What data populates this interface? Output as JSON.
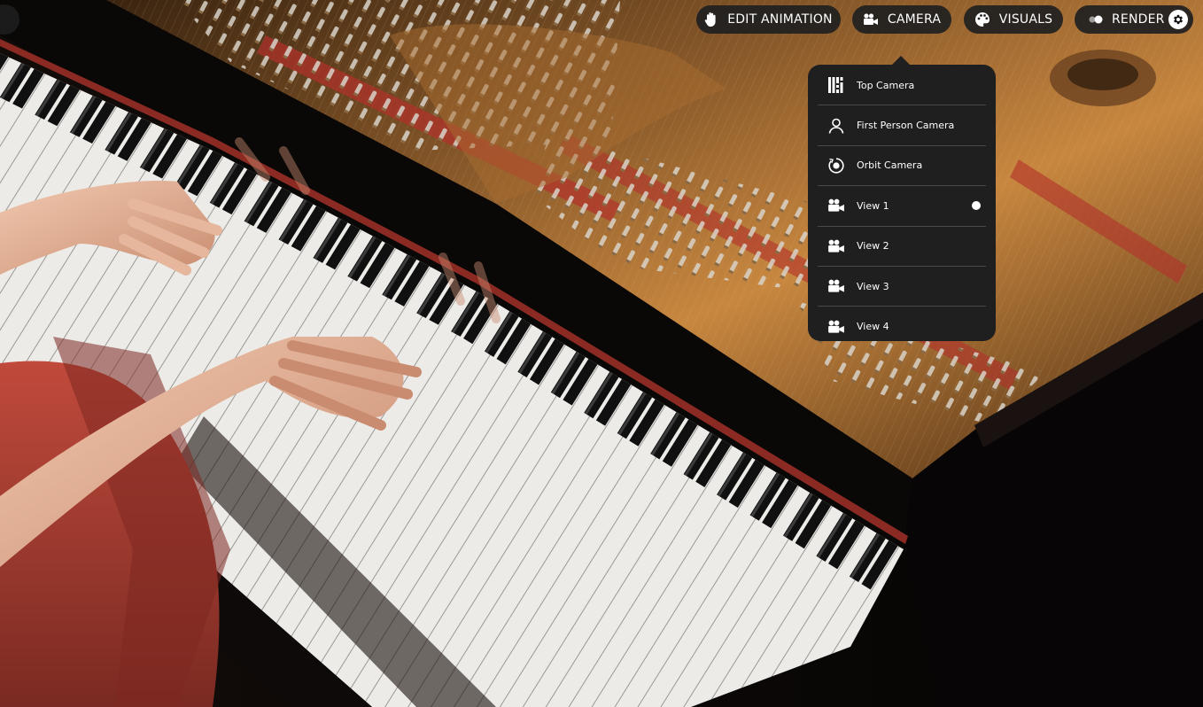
{
  "toolbar": {
    "edit_animation": {
      "label": "EDIT ANIMATION",
      "icon": "hand-icon"
    },
    "camera": {
      "label": "CAMERA",
      "icon": "video-camera-icon"
    },
    "visuals": {
      "label": "VISUALS",
      "icon": "palette-icon"
    },
    "render": {
      "label": "RENDER",
      "icon": "render-icon",
      "settings_icon": "gear-icon"
    }
  },
  "camera_menu": {
    "items": [
      {
        "label": "Top Camera",
        "icon": "top-camera-icon",
        "selected": false
      },
      {
        "label": "First Person Camera",
        "icon": "person-icon",
        "selected": false
      },
      {
        "label": "Orbit Camera",
        "icon": "orbit-icon",
        "selected": false
      },
      {
        "label": "View 1",
        "icon": "video-camera-icon",
        "selected": true
      },
      {
        "label": "View 2",
        "icon": "video-camera-icon",
        "selected": false
      },
      {
        "label": "View 3",
        "icon": "video-camera-icon",
        "selected": false
      },
      {
        "label": "View 4",
        "icon": "video-camera-icon",
        "selected": false
      }
    ]
  },
  "colors": {
    "panel": "#1f1f1f",
    "pill": "#202020",
    "text": "#ffffff",
    "piano_gold": "#c8873f",
    "felt_red": "#b2312b"
  }
}
